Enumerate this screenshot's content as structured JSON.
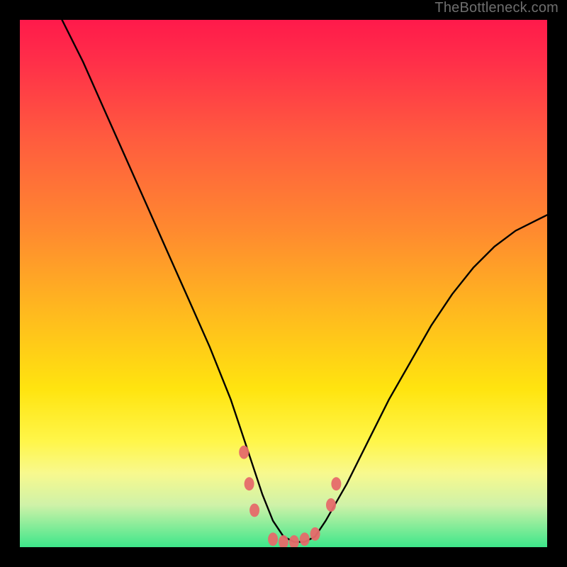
{
  "watermark": "TheBottleneck.com",
  "colors": {
    "background": "#000000",
    "curve": "#000000",
    "marker": "#e66a6a"
  },
  "chart_data": {
    "type": "line",
    "title": "",
    "xlabel": "",
    "ylabel": "",
    "xlim": [
      0,
      100
    ],
    "ylim": [
      0,
      100
    ],
    "grid": false,
    "legend": false,
    "series": [
      {
        "name": "bottleneck-curve",
        "x": [
          8,
          12,
          16,
          20,
          24,
          28,
          32,
          36,
          40,
          42,
          44,
          46,
          48,
          50,
          52,
          54,
          56,
          58,
          62,
          66,
          70,
          74,
          78,
          82,
          86,
          90,
          94,
          98,
          100
        ],
        "y": [
          100,
          92,
          83,
          74,
          65,
          56,
          47,
          38,
          28,
          22,
          16,
          10,
          5,
          2,
          1,
          1,
          2,
          5,
          12,
          20,
          28,
          35,
          42,
          48,
          53,
          57,
          60,
          62,
          63
        ]
      }
    ],
    "markers": [
      {
        "x": 42.5,
        "y": 18
      },
      {
        "x": 43.5,
        "y": 12
      },
      {
        "x": 44.5,
        "y": 7
      },
      {
        "x": 48,
        "y": 1.5
      },
      {
        "x": 50,
        "y": 1
      },
      {
        "x": 52,
        "y": 1
      },
      {
        "x": 54,
        "y": 1.5
      },
      {
        "x": 56,
        "y": 2.5
      },
      {
        "x": 59,
        "y": 8
      },
      {
        "x": 60,
        "y": 12
      }
    ],
    "marker_size_px": 14
  }
}
